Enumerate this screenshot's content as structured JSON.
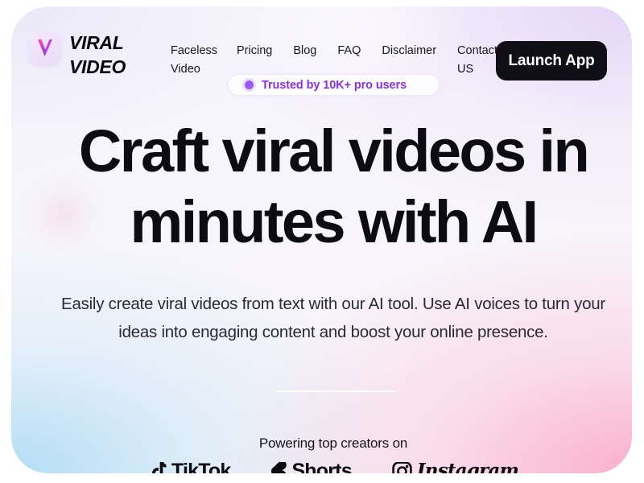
{
  "brand": {
    "name_line1": "VIRAL",
    "name_line2": "VIDEO",
    "logo_icon": "v-checkmark-logo-icon"
  },
  "nav": {
    "items": [
      {
        "label": "Faceless Video"
      },
      {
        "label": "Pricing"
      },
      {
        "label": "Blog"
      },
      {
        "label": "FAQ"
      },
      {
        "label": "Disclaimer"
      },
      {
        "label": "Contact US"
      }
    ],
    "cta_label": "Launch App"
  },
  "badge": {
    "text": "Trusted by 10K+ pro users",
    "dot_color": "#9a5cf0",
    "text_color": "#8a2fe8"
  },
  "hero": {
    "headline_line1": "Craft viral videos in",
    "headline_line2": "minutes with AI",
    "subtext_line1": "Easily create viral videos from text with our AI tool. Use AI voices to turn your",
    "subtext_line2": "ideas into engaging content and boost your online presence."
  },
  "social_proof": {
    "label": "Powering top creators on",
    "logos": [
      {
        "name": "TikTok",
        "icon": "tiktok-note-icon"
      },
      {
        "name": "Shorts",
        "icon": "youtube-shorts-icon"
      },
      {
        "name": "Instagram",
        "icon": "instagram-camera-icon"
      }
    ]
  },
  "theme": {
    "card_radius": "46px",
    "cta_background": "#110f16",
    "cta_text": "#ffffff",
    "gradient_top_left": "#f0eefa",
    "gradient_top_right": "#e6daf7",
    "gradient_bottom_left": "#c6e4f6",
    "gradient_bottom_right": "#f9c3d8"
  }
}
